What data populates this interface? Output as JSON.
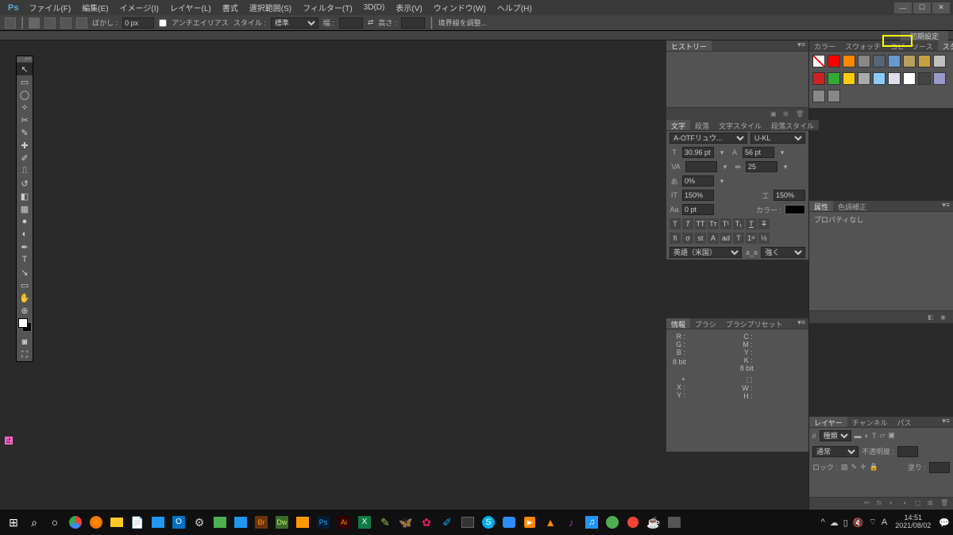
{
  "menu": [
    "ファイル(F)",
    "編集(E)",
    "イメージ(I)",
    "レイヤー(L)",
    "書式",
    "選択範囲(S)",
    "フィルター(T)",
    "3D(D)",
    "表示(V)",
    "ウィンドウ(W)",
    "ヘルプ(H)"
  ],
  "options": {
    "feather_label": "ぼかし :",
    "feather_value": "0 px",
    "antialias": "アンチエイリアス",
    "style_label": "スタイル :",
    "style_value": "標準",
    "width_label": "幅 :",
    "height_label": "高さ :",
    "refine_edge": "境界線を調整..."
  },
  "secondary": {
    "label": "初期設定"
  },
  "panels": {
    "history": {
      "tab": "ヒストリー"
    },
    "character": {
      "tabs": [
        "文字",
        "段落",
        "文字スタイル",
        "段落スタイル"
      ],
      "font": "A-OTFリュウ...",
      "weight": "U-KL",
      "size": "30.96 pt",
      "leading": "56 pt",
      "va": "VA",
      "vanum": "25",
      "tsume": "0%",
      "vscale": "150%",
      "hscale": "150%",
      "baseline": "0 pt",
      "color_label": "カラー :",
      "lang": "英語（米国）",
      "aa_label": "a_a",
      "aa": "強く"
    },
    "info": {
      "tabs": [
        "情報",
        "ブラシ",
        "ブラシプリセット"
      ],
      "r": "R :",
      "g": "G :",
      "b": "B :",
      "c": "C :",
      "m": "M :",
      "y": "Y :",
      "k": "K :",
      "depth1": "8 bit",
      "depth2": "8 bit",
      "x": "X :",
      "ypos": "Y :",
      "w": "W :",
      "h": "H :"
    },
    "swatches": {
      "tabs": [
        "カラー",
        "スウォッチ",
        "コピーソース",
        "スタイル"
      ],
      "colors_row1": [
        "#ffffff00",
        "#ff0000",
        "#ff8800",
        "#888888",
        "#556677",
        "#6699cc",
        "#b8a060",
        "#c8a040",
        "#c0c0c0"
      ],
      "colors_row2": [
        "#cc2222",
        "#33aa33",
        "#ffcc00",
        "#aaaaaa",
        "#88ccff",
        "#ddddee",
        "#ffffff",
        "#444444",
        "#9999cc"
      ],
      "colors_row3": [
        "#888888",
        "#888888"
      ]
    },
    "props": {
      "tabs": [
        "属性",
        "色調補正"
      ],
      "empty": "プロパティなし"
    },
    "layers": {
      "tabs": [
        "レイヤー",
        "チャンネル",
        "パス"
      ],
      "kind": "種類",
      "blend": "通常",
      "opacity_label": "不透明度 :",
      "lock_label": "ロック :",
      "fill_label": "塗り :"
    }
  },
  "tools": [
    "↖",
    "▭",
    "◯",
    "⬚",
    "✂",
    "✎",
    "✐",
    "๑",
    "⌖",
    "⟲",
    "⊹",
    "◐",
    "◧",
    "⬓",
    "▤",
    "T",
    "↘",
    "Q",
    "✋",
    "⊕"
  ],
  "pink": "止",
  "taskbar": {
    "time": "14:51",
    "date": "2021/08/02"
  }
}
